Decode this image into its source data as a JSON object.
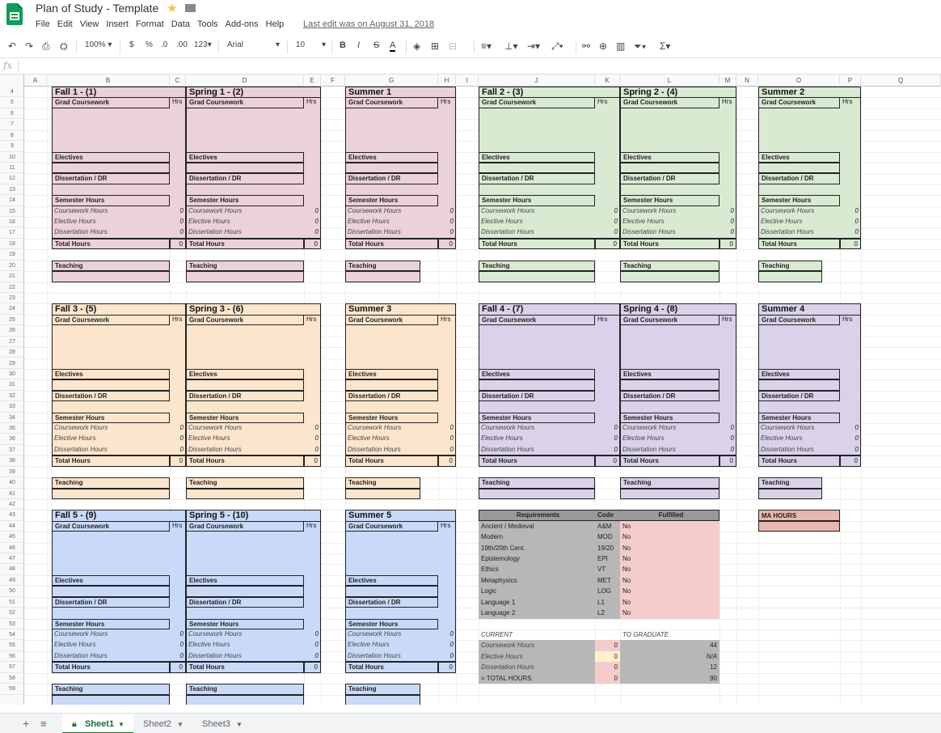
{
  "title": "Plan of Study - Template",
  "last_edit": "Last edit was on August 31, 2018",
  "menu": [
    "File",
    "Edit",
    "View",
    "Insert",
    "Format",
    "Data",
    "Tools",
    "Add-ons",
    "Help"
  ],
  "toolbar": {
    "zoom": "100%",
    "currency": "$",
    "percent": "%",
    "dec_dec": ".0",
    "inc_dec": ".00",
    "format123": "123",
    "font": "Arial",
    "font_size": "10",
    "bold": "B",
    "italic": "I",
    "strike": "S",
    "textcolor": "A"
  },
  "formula_prefix": "fx",
  "columns": [
    "A",
    "B",
    "C",
    "D",
    "E",
    "F",
    "G",
    "H",
    "I",
    "J",
    "K",
    "L",
    "M",
    "N",
    "O",
    "P",
    "Q"
  ],
  "rows": [
    "4",
    "5",
    "6",
    "7",
    "8",
    "9",
    "10",
    "11",
    "12",
    "13",
    "14",
    "15",
    "16",
    "17",
    "18",
    "19",
    "20",
    "21",
    "22",
    "23",
    "24",
    "25",
    "26",
    "27",
    "28",
    "29",
    "30",
    "31",
    "32",
    "33",
    "34",
    "35",
    "36",
    "37",
    "38",
    "39",
    "40",
    "41",
    "42",
    "43",
    "44",
    "45",
    "46",
    "47",
    "48",
    "49",
    "50",
    "51",
    "52",
    "53",
    "54",
    "55",
    "56",
    "57",
    "58",
    "59"
  ],
  "labels": {
    "grad": "Grad Coursework",
    "hrs": "Hrs",
    "electives": "Electives",
    "diss": "Dissertation / DR",
    "semhours": "Semester Hours",
    "coursework": "Coursework Hours",
    "elective": "Elective Hours",
    "dissertation": "Dissertation Hours",
    "total": "Total Hours",
    "teaching": "Teaching",
    "zero": "0"
  },
  "semesters": [
    {
      "name": "Fall 1 - (1)"
    },
    {
      "name": "Spring 1 - (2)"
    },
    {
      "name": "Summer 1"
    },
    {
      "name": "Fall 2 - (3)"
    },
    {
      "name": "Spring 2 - (4)"
    },
    {
      "name": "Summer 2"
    },
    {
      "name": "Fall 3 - (5)"
    },
    {
      "name": "Spring 3 - (6)"
    },
    {
      "name": "Summer 3"
    },
    {
      "name": "Fall 4 - (7)"
    },
    {
      "name": "Spring 4 - (8)"
    },
    {
      "name": "Summer 4"
    },
    {
      "name": "Fall 5 - (9)"
    },
    {
      "name": "Spring 5 - (10)"
    },
    {
      "name": "Summer 5"
    }
  ],
  "colors": {
    "pink": "#ead1dc",
    "green": "#d9ead3",
    "orange": "#fce5cd",
    "purple": "#d9d2e9",
    "blue": "#c9daf8",
    "gray": "#b7b7b7",
    "salmon": "#f4cccc",
    "yellow": "#fff2cc",
    "ma": "#e6b8af"
  },
  "requirements": {
    "headers": {
      "req": "Requirements",
      "code": "Code",
      "fulfilled": "Fulfilled"
    },
    "rows": [
      {
        "name": "Ancient / Medieval",
        "code": "A&M",
        "fulfilled": "No"
      },
      {
        "name": "Modern",
        "code": "MOD",
        "fulfilled": "No"
      },
      {
        "name": "19th/20th Cent.",
        "code": "19/20",
        "fulfilled": "No"
      },
      {
        "name": "Epistemology",
        "code": "EPI",
        "fulfilled": "No"
      },
      {
        "name": "Ethics",
        "code": "VT",
        "fulfilled": "No"
      },
      {
        "name": "Metaphysics",
        "code": "MET",
        "fulfilled": "No"
      },
      {
        "name": "Logic",
        "code": "LOG",
        "fulfilled": "No"
      },
      {
        "name": "Language 1",
        "code": "L1",
        "fulfilled": "No"
      },
      {
        "name": "Language 2",
        "code": "L2",
        "fulfilled": "No"
      }
    ]
  },
  "summary": {
    "current": "CURRENT",
    "to_graduate": "TO GRADUATE",
    "rows": [
      {
        "label": "Coursework Hours",
        "current": "0",
        "grad": "44"
      },
      {
        "label": "Elective Hours",
        "current": "0",
        "grad": "N/A"
      },
      {
        "label": "Dissertation Hours",
        "current": "0",
        "grad": "12"
      },
      {
        "label": "= TOTAL HOURS",
        "current": "0",
        "grad": "90"
      }
    ]
  },
  "ma_hours": "MA HOURS",
  "sheets": [
    "Sheet1",
    "Sheet2",
    "Sheet3"
  ]
}
